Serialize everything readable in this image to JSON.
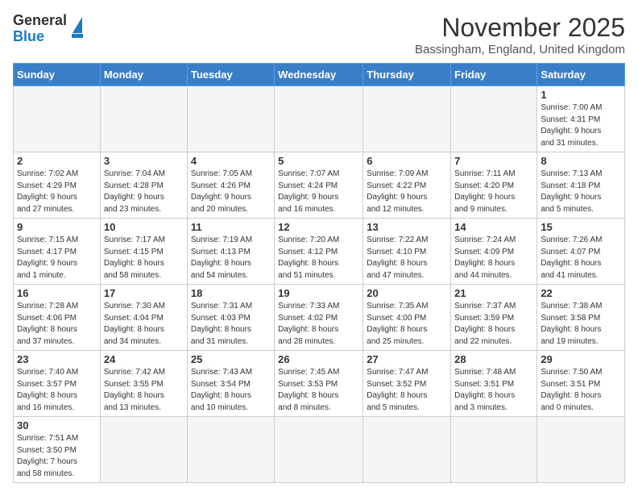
{
  "logo": {
    "text_general": "General",
    "text_blue": "Blue"
  },
  "title": {
    "month": "November 2025",
    "location": "Bassingham, England, United Kingdom"
  },
  "weekdays": [
    "Sunday",
    "Monday",
    "Tuesday",
    "Wednesday",
    "Thursday",
    "Friday",
    "Saturday"
  ],
  "weeks": [
    [
      {
        "day": "",
        "info": ""
      },
      {
        "day": "",
        "info": ""
      },
      {
        "day": "",
        "info": ""
      },
      {
        "day": "",
        "info": ""
      },
      {
        "day": "",
        "info": ""
      },
      {
        "day": "",
        "info": ""
      },
      {
        "day": "1",
        "info": "Sunrise: 7:00 AM\nSunset: 4:31 PM\nDaylight: 9 hours\nand 31 minutes."
      }
    ],
    [
      {
        "day": "2",
        "info": "Sunrise: 7:02 AM\nSunset: 4:29 PM\nDaylight: 9 hours\nand 27 minutes."
      },
      {
        "day": "3",
        "info": "Sunrise: 7:04 AM\nSunset: 4:28 PM\nDaylight: 9 hours\nand 23 minutes."
      },
      {
        "day": "4",
        "info": "Sunrise: 7:05 AM\nSunset: 4:26 PM\nDaylight: 9 hours\nand 20 minutes."
      },
      {
        "day": "5",
        "info": "Sunrise: 7:07 AM\nSunset: 4:24 PM\nDaylight: 9 hours\nand 16 minutes."
      },
      {
        "day": "6",
        "info": "Sunrise: 7:09 AM\nSunset: 4:22 PM\nDaylight: 9 hours\nand 12 minutes."
      },
      {
        "day": "7",
        "info": "Sunrise: 7:11 AM\nSunset: 4:20 PM\nDaylight: 9 hours\nand 9 minutes."
      },
      {
        "day": "8",
        "info": "Sunrise: 7:13 AM\nSunset: 4:18 PM\nDaylight: 9 hours\nand 5 minutes."
      }
    ],
    [
      {
        "day": "9",
        "info": "Sunrise: 7:15 AM\nSunset: 4:17 PM\nDaylight: 9 hours\nand 1 minute."
      },
      {
        "day": "10",
        "info": "Sunrise: 7:17 AM\nSunset: 4:15 PM\nDaylight: 8 hours\nand 58 minutes."
      },
      {
        "day": "11",
        "info": "Sunrise: 7:19 AM\nSunset: 4:13 PM\nDaylight: 8 hours\nand 54 minutes."
      },
      {
        "day": "12",
        "info": "Sunrise: 7:20 AM\nSunset: 4:12 PM\nDaylight: 8 hours\nand 51 minutes."
      },
      {
        "day": "13",
        "info": "Sunrise: 7:22 AM\nSunset: 4:10 PM\nDaylight: 8 hours\nand 47 minutes."
      },
      {
        "day": "14",
        "info": "Sunrise: 7:24 AM\nSunset: 4:09 PM\nDaylight: 8 hours\nand 44 minutes."
      },
      {
        "day": "15",
        "info": "Sunrise: 7:26 AM\nSunset: 4:07 PM\nDaylight: 8 hours\nand 41 minutes."
      }
    ],
    [
      {
        "day": "16",
        "info": "Sunrise: 7:28 AM\nSunset: 4:06 PM\nDaylight: 8 hours\nand 37 minutes."
      },
      {
        "day": "17",
        "info": "Sunrise: 7:30 AM\nSunset: 4:04 PM\nDaylight: 8 hours\nand 34 minutes."
      },
      {
        "day": "18",
        "info": "Sunrise: 7:31 AM\nSunset: 4:03 PM\nDaylight: 8 hours\nand 31 minutes."
      },
      {
        "day": "19",
        "info": "Sunrise: 7:33 AM\nSunset: 4:02 PM\nDaylight: 8 hours\nand 28 minutes."
      },
      {
        "day": "20",
        "info": "Sunrise: 7:35 AM\nSunset: 4:00 PM\nDaylight: 8 hours\nand 25 minutes."
      },
      {
        "day": "21",
        "info": "Sunrise: 7:37 AM\nSunset: 3:59 PM\nDaylight: 8 hours\nand 22 minutes."
      },
      {
        "day": "22",
        "info": "Sunrise: 7:38 AM\nSunset: 3:58 PM\nDaylight: 8 hours\nand 19 minutes."
      }
    ],
    [
      {
        "day": "23",
        "info": "Sunrise: 7:40 AM\nSunset: 3:57 PM\nDaylight: 8 hours\nand 16 minutes."
      },
      {
        "day": "24",
        "info": "Sunrise: 7:42 AM\nSunset: 3:55 PM\nDaylight: 8 hours\nand 13 minutes."
      },
      {
        "day": "25",
        "info": "Sunrise: 7:43 AM\nSunset: 3:54 PM\nDaylight: 8 hours\nand 10 minutes."
      },
      {
        "day": "26",
        "info": "Sunrise: 7:45 AM\nSunset: 3:53 PM\nDaylight: 8 hours\nand 8 minutes."
      },
      {
        "day": "27",
        "info": "Sunrise: 7:47 AM\nSunset: 3:52 PM\nDaylight: 8 hours\nand 5 minutes."
      },
      {
        "day": "28",
        "info": "Sunrise: 7:48 AM\nSunset: 3:51 PM\nDaylight: 8 hours\nand 3 minutes."
      },
      {
        "day": "29",
        "info": "Sunrise: 7:50 AM\nSunset: 3:51 PM\nDaylight: 8 hours\nand 0 minutes."
      }
    ],
    [
      {
        "day": "30",
        "info": "Sunrise: 7:51 AM\nSunset: 3:50 PM\nDaylight: 7 hours\nand 58 minutes."
      },
      {
        "day": "",
        "info": ""
      },
      {
        "day": "",
        "info": ""
      },
      {
        "day": "",
        "info": ""
      },
      {
        "day": "",
        "info": ""
      },
      {
        "day": "",
        "info": ""
      },
      {
        "day": "",
        "info": ""
      }
    ]
  ]
}
